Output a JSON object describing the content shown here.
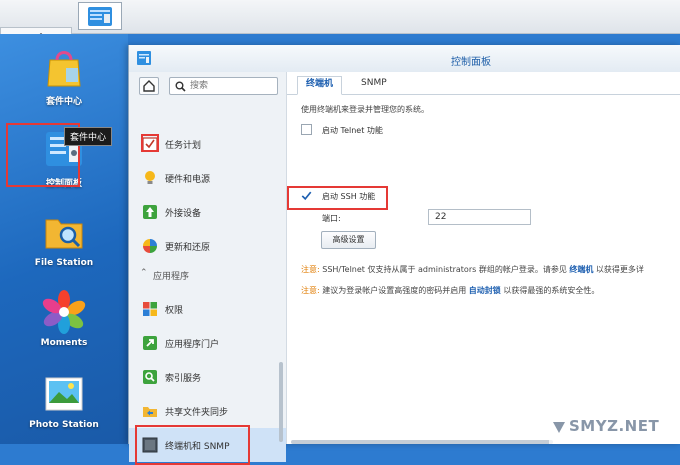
{
  "colors": {
    "accent": "#1d5fb0",
    "highlight": "#e53935",
    "note": "#e07b00",
    "desktop": "#2d7bd0"
  },
  "taskbar": {
    "icons": [
      "main-menu-grid-icon",
      "control-panel-app-icon"
    ]
  },
  "desktop": {
    "icons": [
      {
        "label": "套件中心",
        "icon": "package-center-icon"
      },
      {
        "label": "控制面板",
        "icon": "control-panel-icon"
      },
      {
        "label": "File Station",
        "icon": "folder-search-icon"
      },
      {
        "label": "Moments",
        "icon": "flower-icon"
      },
      {
        "label": "Photo Station",
        "icon": "photo-icon"
      }
    ],
    "tooltip": "套件中心"
  },
  "window": {
    "title": "控制面板",
    "search_placeholder": "搜索",
    "sidebar": {
      "items": [
        {
          "label": "任务计划",
          "icon": "task-scheduler-icon"
        },
        {
          "label": "硬件和电源",
          "icon": "lightbulb-icon"
        },
        {
          "label": "外接设备",
          "icon": "external-device-icon"
        },
        {
          "label": "更新和还原",
          "icon": "update-restore-icon"
        },
        {
          "label": "权限",
          "icon": "privileges-icon"
        },
        {
          "label": "应用程序门户",
          "icon": "app-portal-icon"
        },
        {
          "label": "索引服务",
          "icon": "indexing-service-icon"
        },
        {
          "label": "共享文件夹同步",
          "icon": "shared-folder-sync-icon"
        },
        {
          "label": "终端机和 SNMP",
          "icon": "terminal-icon"
        }
      ],
      "section": "应用程序"
    },
    "tabs": [
      "终端机",
      "SNMP"
    ],
    "description": "使用终端机来登录并管理您的系统。",
    "telnet_label": "启动 Telnet 功能",
    "ssh_label": "启动 SSH 功能",
    "port_label": "端口:",
    "port_value": "22",
    "advanced_button": "高级设置",
    "note1": {
      "label": "注意:",
      "text": "SSH/Telnet 仅支持从属于 administrators 群组的帐户登录。请参见",
      "link": "终端机",
      "after": "以获得更多详"
    },
    "note2": {
      "label": "注意:",
      "text": "建议为登录帐户设置高强度的密码并启用",
      "link": "自动封锁",
      "after": "以获得最强的系统安全性。"
    }
  },
  "watermark": "SMYZ.NET"
}
